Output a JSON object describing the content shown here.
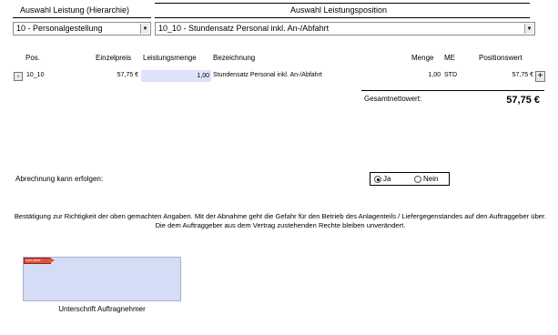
{
  "header": {
    "left_title": "Auswahl Leistung (Hierarchie)",
    "right_title": "Auswahl Leistungsposition"
  },
  "selects": {
    "hierarchy_value": "10 - Personalgestellung",
    "position_value": "10_10 - Stundensatz Personal inkl. An-/Abfahrt"
  },
  "table": {
    "columns": {
      "pos": "Pos.",
      "unit_price": "Einzelpreis",
      "quantity": "Leistungsmenge",
      "description": "Bezeichnung",
      "amount": "Menge",
      "unit": "ME",
      "position_value": "Positionswert"
    },
    "row": {
      "remove_label": "-",
      "pos": "10_10",
      "unit_price": "57,75 €",
      "quantity": "1,00",
      "description": "Stundensatz Personal inkl. An-/Abfahrt",
      "amount": "1,00",
      "unit": "STD",
      "position_value": "57,75 €",
      "add_label": "+"
    }
  },
  "total": {
    "label": "Gesamtnettowert:",
    "value": "57,75 €"
  },
  "billing": {
    "question": "Abrechnung kann erfolgen:",
    "yes": "Ja",
    "no": "Nein",
    "selected": "Ja"
  },
  "confirmation": {
    "text": "Bestätigung zur Richtigkeit der oben gemachten Angaben. Mit der Abnahme geht die Gefahr für den Betrieb des Anlagenteils / Liefergegenstandes auf den Auftraggeber über. Die dem Auftraggeber aus dem Vertrag zustehenden Rechte bleiben unverändert."
  },
  "signature": {
    "flag_text": "SIGN HERE",
    "label": "Unterschrift Auftragnehmer"
  },
  "colors": {
    "field_fill": "#dce3fb",
    "signature_fill": "#d5dcf6",
    "flag": "#e0523f"
  },
  "icons": {
    "dropdown": "chevron-down-icon",
    "radio_on": "radio-selected",
    "radio_off": "radio-unselected"
  }
}
